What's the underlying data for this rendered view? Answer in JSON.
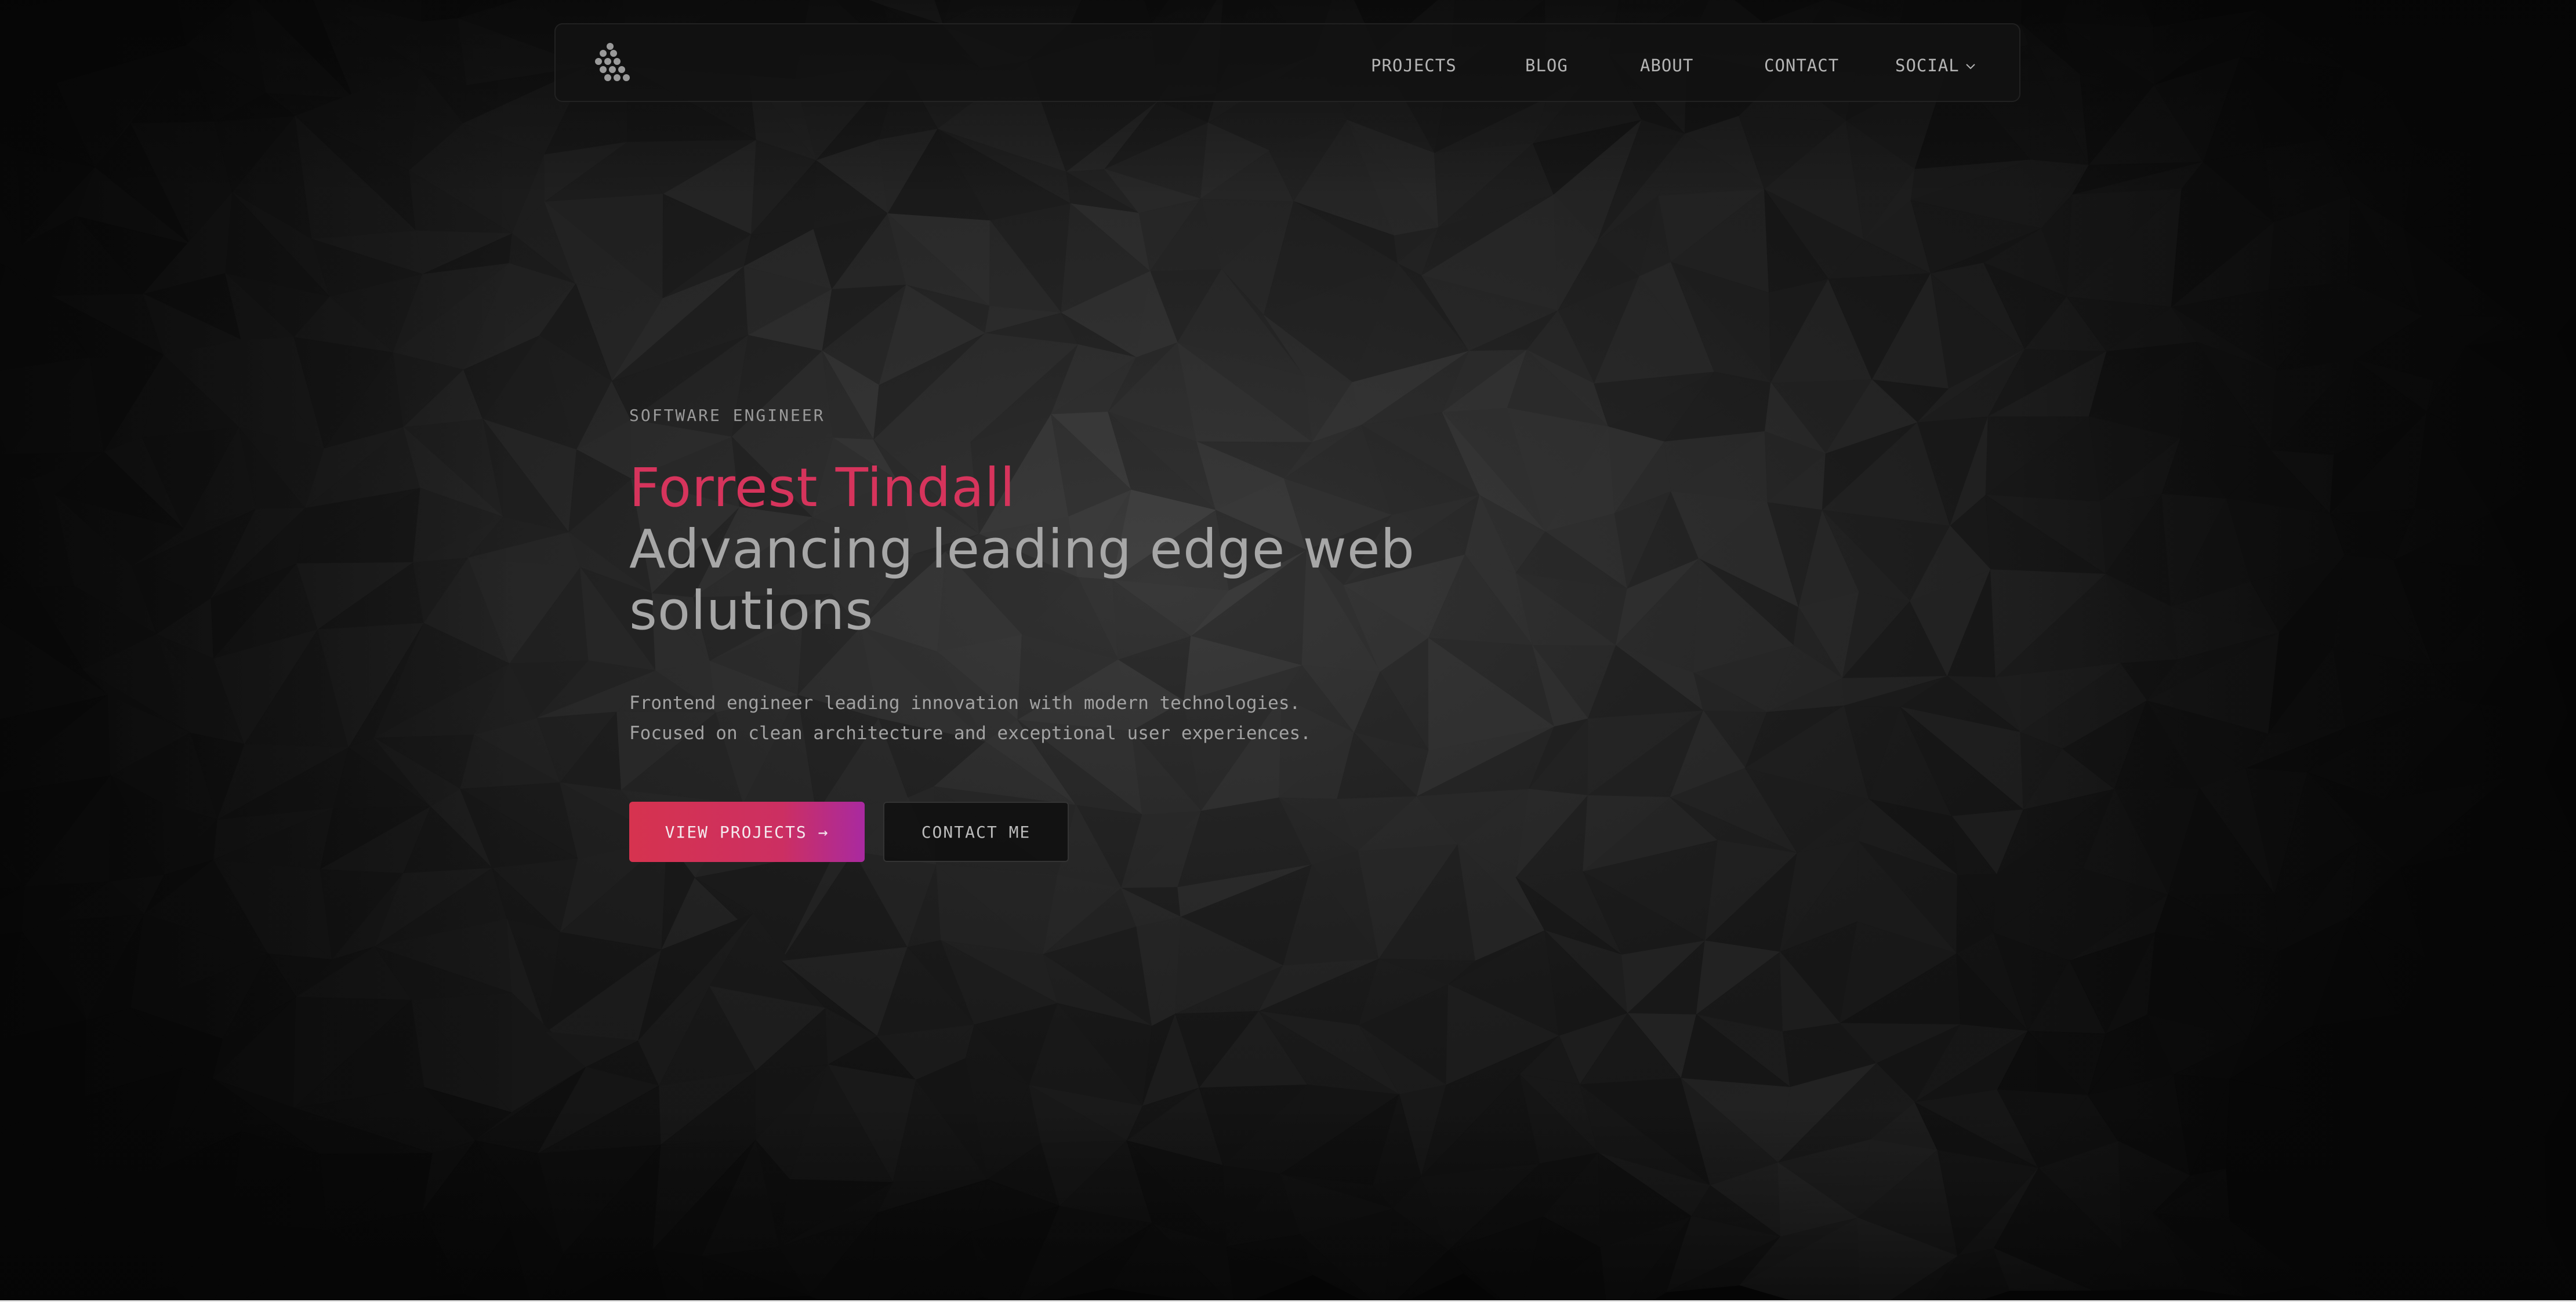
{
  "nav": {
    "links": [
      "PROJECTS",
      "BLOG",
      "ABOUT",
      "CONTACT"
    ],
    "social_label": "SOCIAL"
  },
  "hero": {
    "eyebrow": "SOFTWARE ENGINEER",
    "name": "Forrest Tindall",
    "tagline": "Advancing leading edge web solutions",
    "description": "Frontend engineer leading innovation with modern technologies. Focused on clean architecture and exceptional user experiences.",
    "primary_button": "VIEW PROJECTS →",
    "secondary_button": "CONTACT ME"
  },
  "colors": {
    "background": "#050505",
    "accent": "#d6345c",
    "accent_gradient_end": "#a92aa0",
    "text_muted": "#a7a7a7"
  },
  "icons": {
    "logo": "hexagon-dot-cluster-logo",
    "dropdown": "chevron-down-icon"
  }
}
